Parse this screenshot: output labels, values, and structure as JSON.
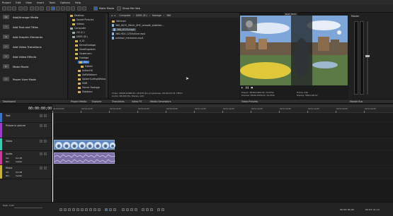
{
  "menu": [
    "Project",
    "Edit",
    "View",
    "Insert",
    "Tools",
    "Options",
    "Help"
  ],
  "toolbar": {
    "show_me_how": "Show Me How",
    "make_movie": "Make Movie"
  },
  "wizard": {
    "items": [
      "Add/Arrange Media",
      "Add Text and Titles",
      "Add Graphic Elements",
      "Add Video Transitions",
      "Add Video Effects",
      "Make Movie",
      "Power User Mode"
    ]
  },
  "tree": {
    "items": [
      "Desktop",
      "Saved Pictures",
      "Videos",
      "Computer",
      "OS (C:)",
      "DATA (D:)",
      "4,10",
      "DemoFootage",
      "Gesellsgraten",
      "Gowercam",
      "Footage",
      "Win",
      "Edited",
      "ActionHX",
      "SoftWildcam",
      "SpiderSurfingWildcam",
      "HDR",
      "Horror Footage",
      "Slatation"
    ]
  },
  "path": {
    "items": [
      "Computer",
      "DATA (D:)",
      "footage",
      "360"
    ]
  },
  "files": {
    "items": [
      "Stitched",
      "360_0015_Stitch_XHC_smooth_stabilize...",
      "360_0173.mp4",
      "360-HD1-1255shlive.mp4",
      "outdoor_memories.mp4"
    ],
    "info_line1": "Video: 4096x2048x32, 29,970 fps progressive, 00:00:22:15, HEVC",
    "info_line2": "Audio: 48,000 Hz, Stereo, AAC"
  },
  "preview": {
    "quality": "Best (Full)",
    "project": "Project: 3840x1920x32, 29,970p",
    "preview": "Preview: 3840x1920x32, 29,970p",
    "frame_label": "Frame: 240",
    "display_label": "Display: 384x192x32"
  },
  "meters": {
    "title": "Master"
  },
  "tabs": [
    "Project Media",
    "Explorer",
    "Transitions",
    "Video FX",
    "Media Generators",
    "Video Preview",
    "Master Bus"
  ],
  "timeline": {
    "timecode": "00:00:00;00",
    "ruler_marks": [
      "00:00:00;00",
      "00:00:14;29",
      "00:00:29;29",
      "00:00:44;29",
      "00:00:59;28",
      "00:01:14;29",
      "00:01:29;29",
      "00:01:44;29",
      "00:01:59;28",
      "00:02:14;29",
      "00:02:29;29",
      "00:02:44;29"
    ],
    "tracks": [
      {
        "name": "Text",
        "color": "#3b74c9"
      },
      {
        "name": "Picture in picture",
        "color": "#9b3bc9"
      },
      {
        "name": "Video",
        "color": "#3bc9b0"
      },
      {
        "name": "Audio",
        "color": "#c93b9b"
      },
      {
        "name": "Music",
        "color": "#c9b13b"
      }
    ],
    "vol_label": "Vol:",
    "pan_label": "Pan:",
    "vol_value": "0,0 dB",
    "pan_value": "Center"
  },
  "status": {
    "rate": "Rate: 0,00",
    "time": "00:00:00;00",
    "end_time": "00:03:43;14"
  },
  "colors": {
    "accent": "#3a7bd5",
    "clip": "#5e87c4"
  }
}
